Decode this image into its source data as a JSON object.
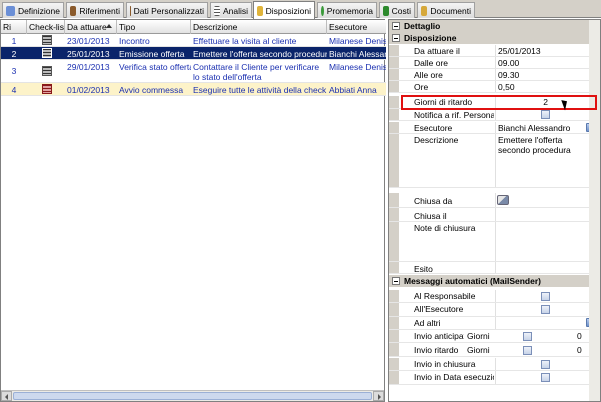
{
  "tabs": [
    {
      "label": "Definizione",
      "icon": "document-icon",
      "color": "#6b8fd6"
    },
    {
      "label": "Riferimenti",
      "icon": "contacts-icon",
      "color": "#8a5a2b"
    },
    {
      "label": "Dati Personalizzati",
      "icon": "custom-data-icon",
      "color": "#8a5a2b"
    },
    {
      "label": "Analisi",
      "icon": "list-icon",
      "color": "#555555"
    },
    {
      "label": "Disposizioni",
      "icon": "folder-icon",
      "color": "#e0b43a"
    },
    {
      "label": "Promemoria",
      "icon": "reminder-icon",
      "color": "#3a9a3a"
    },
    {
      "label": "Costi",
      "icon": "money-icon",
      "color": "#2d8a2d"
    },
    {
      "label": "Documenti",
      "icon": "documents-icon",
      "color": "#d6a83a"
    }
  ],
  "grid": {
    "columns": [
      "Ri",
      "Check-list",
      "Da attuare",
      "Tipo",
      "Descrizione",
      "Esecutore"
    ],
    "rows": [
      {
        "num": "1",
        "date": "23/01/2013",
        "tipo": "Incontro",
        "descr": "Effettuare la visita al cliente",
        "esec": "Milanese Denis",
        "state": "normal",
        "icon": "checklist-icon"
      },
      {
        "num": "2",
        "date": "25/01/2013",
        "tipo": "Emissione offerta",
        "descr": "Emettere l'offerta secondo procedura",
        "esec": "Bianchi Alessandro",
        "state": "selected",
        "icon": "checklist-icon"
      },
      {
        "num": "3",
        "date": "29/01/2013",
        "tipo": "Verifica stato offerta",
        "descr": "Contattare il Cliente per verificare lo stato dell'offerta",
        "esec": "Milanese Denis",
        "state": "normal",
        "icon": "checklist-icon"
      },
      {
        "num": "4",
        "date": "01/02/2013",
        "tipo": "Avvio commessa",
        "descr": "Eseguire tutte le attività della check list",
        "esec": "Abbiati Anna",
        "state": "highlight",
        "icon": "checklist-red-icon"
      }
    ]
  },
  "panel": {
    "header": "Dettaglio",
    "section1": "Disposizione",
    "fields": {
      "da_attuare_label": "Da attuare il",
      "da_attuare": "25/01/2013",
      "dalle_label": "Dalle ore",
      "dalle": "09.00",
      "alle_label": "Alle ore",
      "alle": "09.30",
      "ore_label": "Ore",
      "ore": "0,50",
      "giorni_label": "Giorni di ritardo",
      "giorni": "2",
      "notifica_label": "Notifica a rif. Personale",
      "esecutore_label": "Esecutore",
      "esecutore": "Bianchi Alessandro",
      "descrizione_label": "Descrizione",
      "descrizione": "Emettere l'offerta secondo procedura",
      "chiusa_da_label": "Chiusa da",
      "chiusa_il_label": "Chiusa il",
      "note_label": "Note di chiusura",
      "esito_label": "Esito"
    },
    "section2": "Messaggi automatici (MailSender)",
    "mail": {
      "responsabile_label": "Al Responsabile",
      "esecutore_label": "All'Esecutore",
      "altri_label": "Ad altri",
      "anticipato_label": "Invio anticipat",
      "anticipato_unit": "Giorni",
      "anticipato_val": "0",
      "ritardo_label": "Invio ritardo",
      "ritardo_unit": "Giorni",
      "ritardo_val": "0",
      "chiusura_label": "Invio in chiusura",
      "data_esec_label": "Invio in Data esecuzion"
    }
  },
  "colors": {
    "selection": "#0a246a",
    "row_highlight": "#fdf3c9",
    "text_link": "#1a2fb0",
    "annotation": "#e01010"
  }
}
